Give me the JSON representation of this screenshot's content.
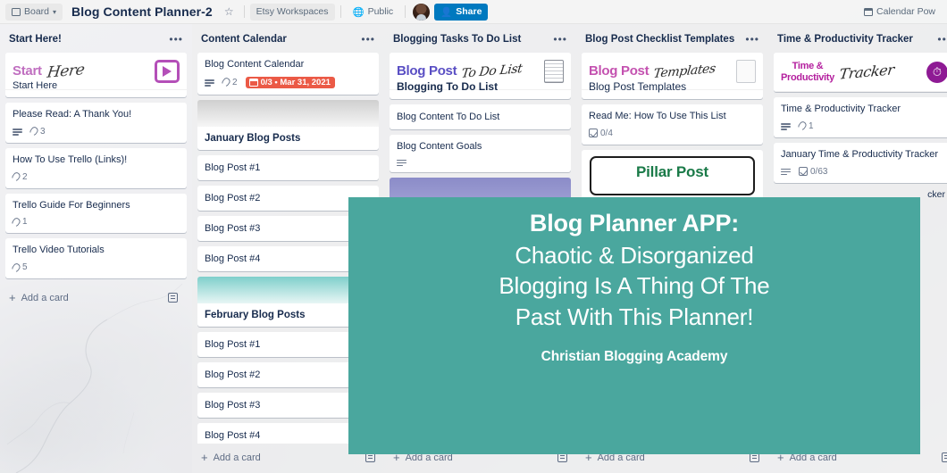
{
  "header": {
    "board_button": "Board",
    "board_icon": "board-grid-icon",
    "title": "Blog Content Planner-2",
    "star_icon": "star-icon",
    "workspace": "Etsy Workspaces",
    "visibility": "Public",
    "visibility_icon": "globe-icon",
    "share": "Share",
    "share_icon": "person-add-icon",
    "powerup": "Calendar Pow",
    "powerup_icon": "calendar-icon",
    "share_color": "#0079bf"
  },
  "add_card_label": "Add a card",
  "add_card_icon": "plus-icon",
  "template_icon": "card-template-icon",
  "list_menu_icon": "ellipsis-icon",
  "promo": {
    "line1": "Blog Planner APP:",
    "line2": "Chaotic & Disorganized",
    "line3": "Blogging Is A Thing Of The",
    "line4": "Past With This Planner!",
    "brand": "Christian Blogging Academy",
    "bg_color": "#4aa79e"
  },
  "sliver_text": "cker",
  "lists": [
    {
      "title": "Start Here!",
      "cards": [
        {
          "type": "cover",
          "banner_bold": "Start",
          "banner_script": "Here",
          "banner_icon": "play-button-icon",
          "title": "Start Here"
        },
        {
          "type": "card",
          "title": "Please Read: A Thank You!",
          "desc": true,
          "attachments": "3"
        },
        {
          "type": "card",
          "title": "How To Use Trello (Links)!",
          "attachments": "2"
        },
        {
          "type": "card",
          "title": "Trello Guide For Beginners",
          "attachments": "1"
        },
        {
          "type": "card",
          "title": "Trello Video Tutorials",
          "attachments": "5"
        }
      ]
    },
    {
      "title": "Content Calendar",
      "cards": [
        {
          "type": "card",
          "title": "Blog Content Calendar",
          "desc": true,
          "attachments": "2",
          "due": "0/3 • Mar 31, 2021"
        },
        {
          "type": "separator",
          "band": "jan",
          "title": "January Blog Posts"
        },
        {
          "type": "plain",
          "title": "Blog Post #1"
        },
        {
          "type": "plain",
          "title": "Blog Post #2"
        },
        {
          "type": "plain",
          "title": "Blog Post #3"
        },
        {
          "type": "plain",
          "title": "Blog Post #4"
        },
        {
          "type": "separator",
          "band": "feb",
          "title": "February Blog Posts"
        },
        {
          "type": "plain",
          "title": "Blog Post #1"
        },
        {
          "type": "plain",
          "title": "Blog Post #2"
        },
        {
          "type": "plain",
          "title": "Blog Post #3"
        },
        {
          "type": "plain",
          "title": "Blog Post #4"
        },
        {
          "type": "band-only",
          "band": "pink"
        }
      ]
    },
    {
      "title": "Blogging Tasks To Do List",
      "cards": [
        {
          "type": "cover",
          "banner_bold": "Blog Post",
          "banner_script": "To Do List",
          "banner_icon": "document-icon",
          "title": "Blogging To Do List"
        },
        {
          "type": "plain",
          "title": "Blog Content To Do List"
        },
        {
          "type": "card",
          "title": "Blog Content Goals",
          "desc": true
        },
        {
          "type": "band-only",
          "band": "purple"
        }
      ]
    },
    {
      "title": "Blog Post Checklist Templates",
      "cards": [
        {
          "type": "cover",
          "banner_bold": "Blog Post",
          "banner_script": "Templates",
          "banner_icon": "document-icon",
          "title": "Blog Post Templates"
        },
        {
          "type": "card",
          "title": "Read Me: How To Use This List",
          "checklist": "0/4"
        },
        {
          "type": "pillar",
          "title": "Pillar Post"
        }
      ]
    },
    {
      "title": "Time & Productivity Tracker",
      "cards": [
        {
          "type": "cover",
          "banner_bold": "Time &\nProductivity",
          "banner_script": "Tracker",
          "banner_icon": "clock-circle-icon",
          "title": ""
        },
        {
          "type": "card",
          "title": "Time & Productivity Tracker",
          "desc": true,
          "attachments": "1"
        },
        {
          "type": "card",
          "title": "January Time & Productivity Tracker",
          "desc": true,
          "checklist": "0/63"
        }
      ]
    }
  ]
}
